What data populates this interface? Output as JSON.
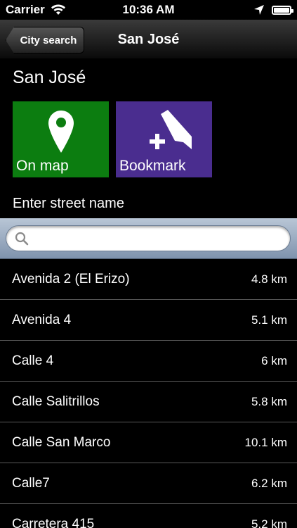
{
  "status_bar": {
    "carrier": "Carrier",
    "time": "10:36 AM"
  },
  "nav": {
    "back_label": "City search",
    "title": "San José"
  },
  "city": {
    "name": "San José"
  },
  "tiles": {
    "on_map_label": "On map",
    "bookmark_label": "Bookmark"
  },
  "street_prompt": "Enter street name",
  "search": {
    "value": "",
    "placeholder": ""
  },
  "streets": [
    {
      "name": "Avenida 2 (El Erizo)",
      "distance": "4.8 km"
    },
    {
      "name": "Avenida 4",
      "distance": "5.1 km"
    },
    {
      "name": "Calle 4",
      "distance": "6 km"
    },
    {
      "name": "Calle Salitrillos",
      "distance": "5.8 km"
    },
    {
      "name": "Calle San Marco",
      "distance": "10.1 km"
    },
    {
      "name": "Calle7",
      "distance": "6.2 km"
    },
    {
      "name": "Carretera 415",
      "distance": "5.2 km"
    }
  ],
  "colors": {
    "on_map_tile": "#0c7d10",
    "bookmark_tile": "#4a2d8f"
  }
}
